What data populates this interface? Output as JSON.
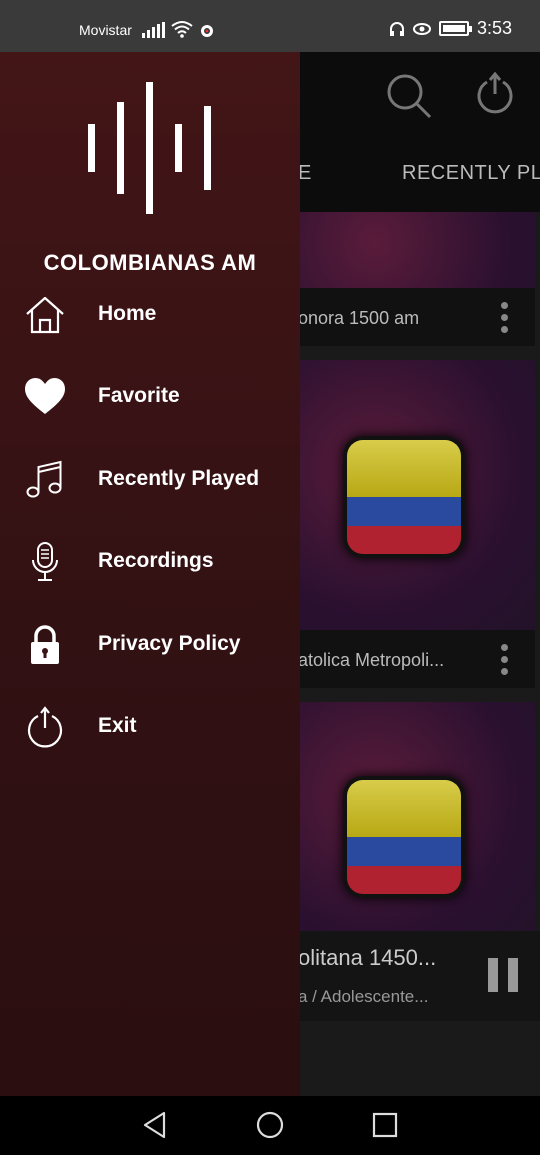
{
  "status_bar": {
    "carrier": "Movistar",
    "time": "3:53"
  },
  "background_app": {
    "tabs": [
      "E",
      "RECENTLY PL"
    ],
    "cards": [
      {
        "title": "onora 1500 am"
      },
      {
        "title": "atolica Metropoli..."
      },
      {
        "title": "olitana 1450..."
      }
    ],
    "player": {
      "title": "olitana 1450...",
      "subtitle": "a / Adolescente..."
    }
  },
  "drawer": {
    "app_name": "COLOMBIANAS AM",
    "items": [
      {
        "label": "Home",
        "icon": "home-icon"
      },
      {
        "label": "Favorite",
        "icon": "heart-icon"
      },
      {
        "label": "Recently Played",
        "icon": "music-note-icon"
      },
      {
        "label": "Recordings",
        "icon": "microphone-icon"
      },
      {
        "label": "Privacy Policy",
        "icon": "lock-icon"
      },
      {
        "label": "Exit",
        "icon": "power-icon"
      }
    ]
  },
  "colors": {
    "drawer_top": "#431517",
    "drawer_bottom": "#2a0e10",
    "flag_yellow": "#d8cc4a",
    "flag_blue": "#2a4aa0",
    "flag_red": "#b02230"
  }
}
